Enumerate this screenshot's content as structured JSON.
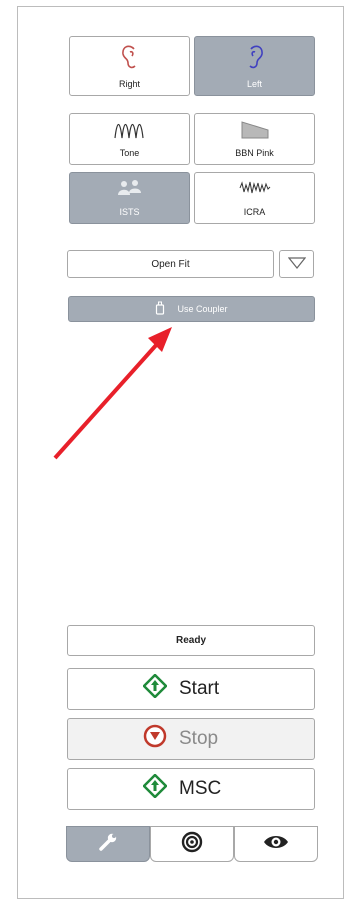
{
  "ear": {
    "right_label": "Right",
    "left_label": "Left",
    "selected": "left"
  },
  "signals": {
    "tone_label": "Tone",
    "bbn_label": "BBN Pink",
    "ists_label": "ISTS",
    "icra_label": "ICRA",
    "selected": "ists"
  },
  "fit": {
    "select_value": "Open Fit"
  },
  "coupler": {
    "label": "Use Coupler"
  },
  "status": {
    "text": "Ready"
  },
  "actions": {
    "start_label": "Start",
    "stop_label": "Stop",
    "msc_label": "MSC"
  },
  "tabs": [
    {
      "icon": "wrench-icon",
      "active": true
    },
    {
      "icon": "target-icon",
      "active": false
    },
    {
      "icon": "eye-icon",
      "active": false
    }
  ],
  "colors": {
    "active_bg": "#a3abb5",
    "right_ear": "#c0504d",
    "left_ear": "#4040c0",
    "start_green": "#1f8a3a",
    "stop_red": "#c0392b",
    "arrow_red": "#e8202a"
  }
}
